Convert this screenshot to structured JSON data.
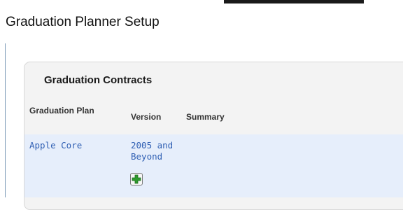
{
  "page": {
    "title": "Graduation Planner Setup"
  },
  "panel": {
    "title": "Graduation Contracts",
    "columns": {
      "plan": "Graduation Plan",
      "version": "Version",
      "summary": "Summary"
    },
    "rows": [
      {
        "plan": "Apple Core",
        "version": "2005 and Beyond",
        "summary": ""
      }
    ],
    "add_icon": "plus-icon"
  },
  "colors": {
    "link": "#2f5fb3",
    "row_band": "#e6eefb",
    "panel_bg": "#f3f3f3",
    "add_icon_green": "#2e9b2e"
  }
}
